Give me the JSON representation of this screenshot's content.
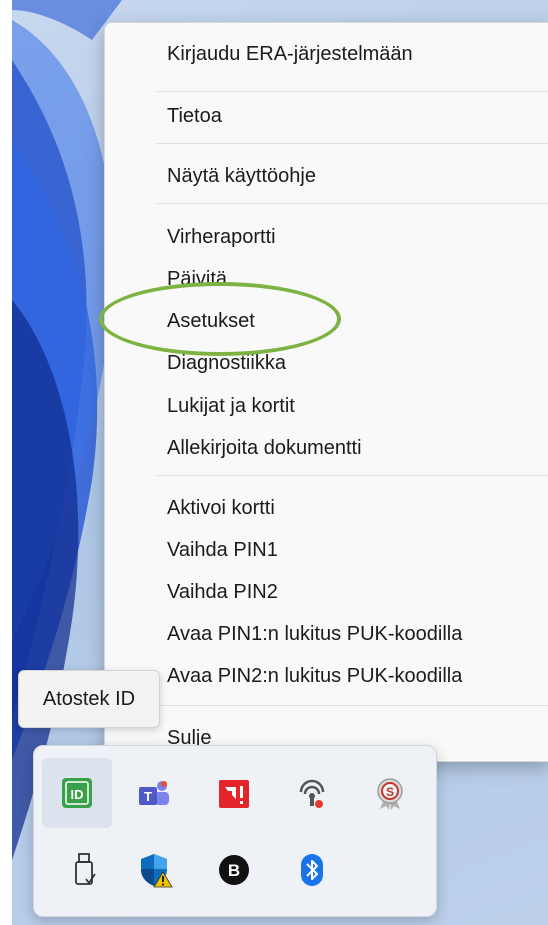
{
  "context_menu": {
    "items": [
      "Kirjaudu ERA-järjestelmään",
      "Tietoa",
      "Näytä käyttöohje",
      "Virheraportti",
      "Päivitä",
      "Asetukset",
      "Diagnostiikka",
      "Lukijat ja kortit",
      "Allekirjoita dokumentti",
      "Aktivoi kortti",
      "Vaihda PIN1",
      "Vaihda PIN2",
      "Avaa PIN1:n lukitus PUK-koodilla",
      "Avaa PIN2:n lukitus PUK-koodilla",
      "Sulje"
    ],
    "highlighted_item": "Asetukset",
    "highlight_color": "#7cb342"
  },
  "tooltip": {
    "text": "Atostek ID"
  },
  "tray": {
    "icons": [
      {
        "name": "atostek-id-icon",
        "label": "ID",
        "color": "#3aa04a"
      },
      {
        "name": "teams-icon",
        "color": "#5b5fc7"
      },
      {
        "name": "amd-warning-icon",
        "color": "#e3242b"
      },
      {
        "name": "webcam-status-icon",
        "color": "#555555"
      },
      {
        "name": "award-badge-icon",
        "color": "#c0392b"
      },
      {
        "name": "usb-drive-icon",
        "color": "#333333"
      },
      {
        "name": "defender-warning-icon",
        "color": "#0f6cbd"
      },
      {
        "name": "b-app-icon",
        "label": "B",
        "color": "#111111"
      },
      {
        "name": "bluetooth-icon",
        "color": "#1a73e8"
      }
    ]
  }
}
